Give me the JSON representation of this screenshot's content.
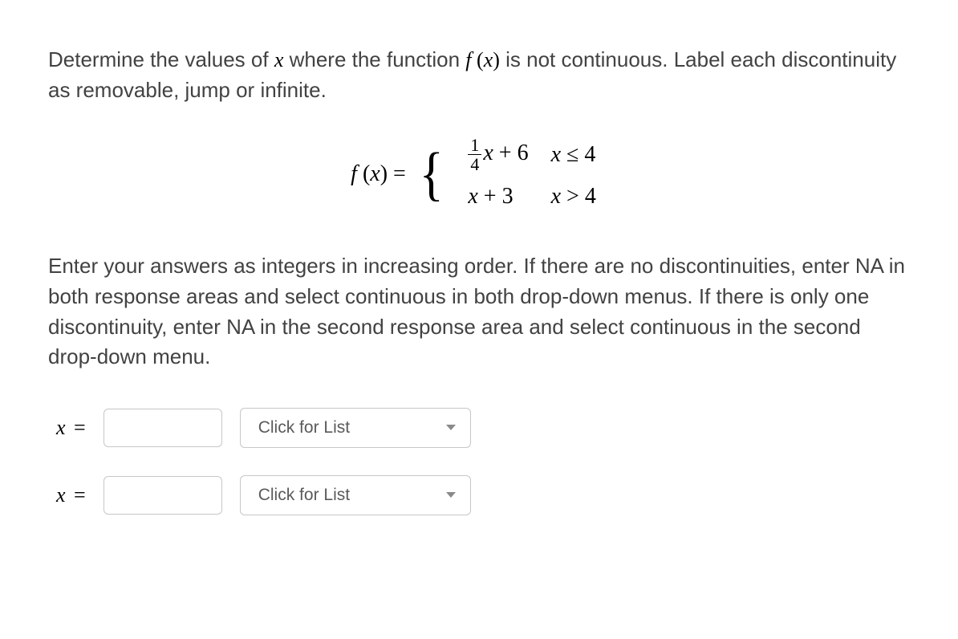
{
  "prompt": {
    "pre": "Determine the values of ",
    "var1_html": "x",
    "mid": " where the function ",
    "fn_html": "f (x)",
    "post": " is not continuous. Label each discontinuity as removable, jump or infinite."
  },
  "equation": {
    "lhs": "f (x) =",
    "cases": [
      {
        "expr_pre": "",
        "frac_num": "1",
        "frac_den": "4",
        "expr_post": "x + 6",
        "cond": "x ≤ 4"
      },
      {
        "expr_pre": "",
        "frac_num": "",
        "frac_den": "",
        "expr_post": "x + 3",
        "cond": "x > 4"
      }
    ]
  },
  "instructions": "Enter your answers as integers in increasing order. If there are no discontinuities, enter NA in both response areas and select continuous in both drop-down menus. If there is only one discontinuity, enter NA in the second response area and select continuous in the second drop-down menu.",
  "answers": {
    "label": "x",
    "equals": "=",
    "dropdown_placeholder": "Click for List"
  }
}
